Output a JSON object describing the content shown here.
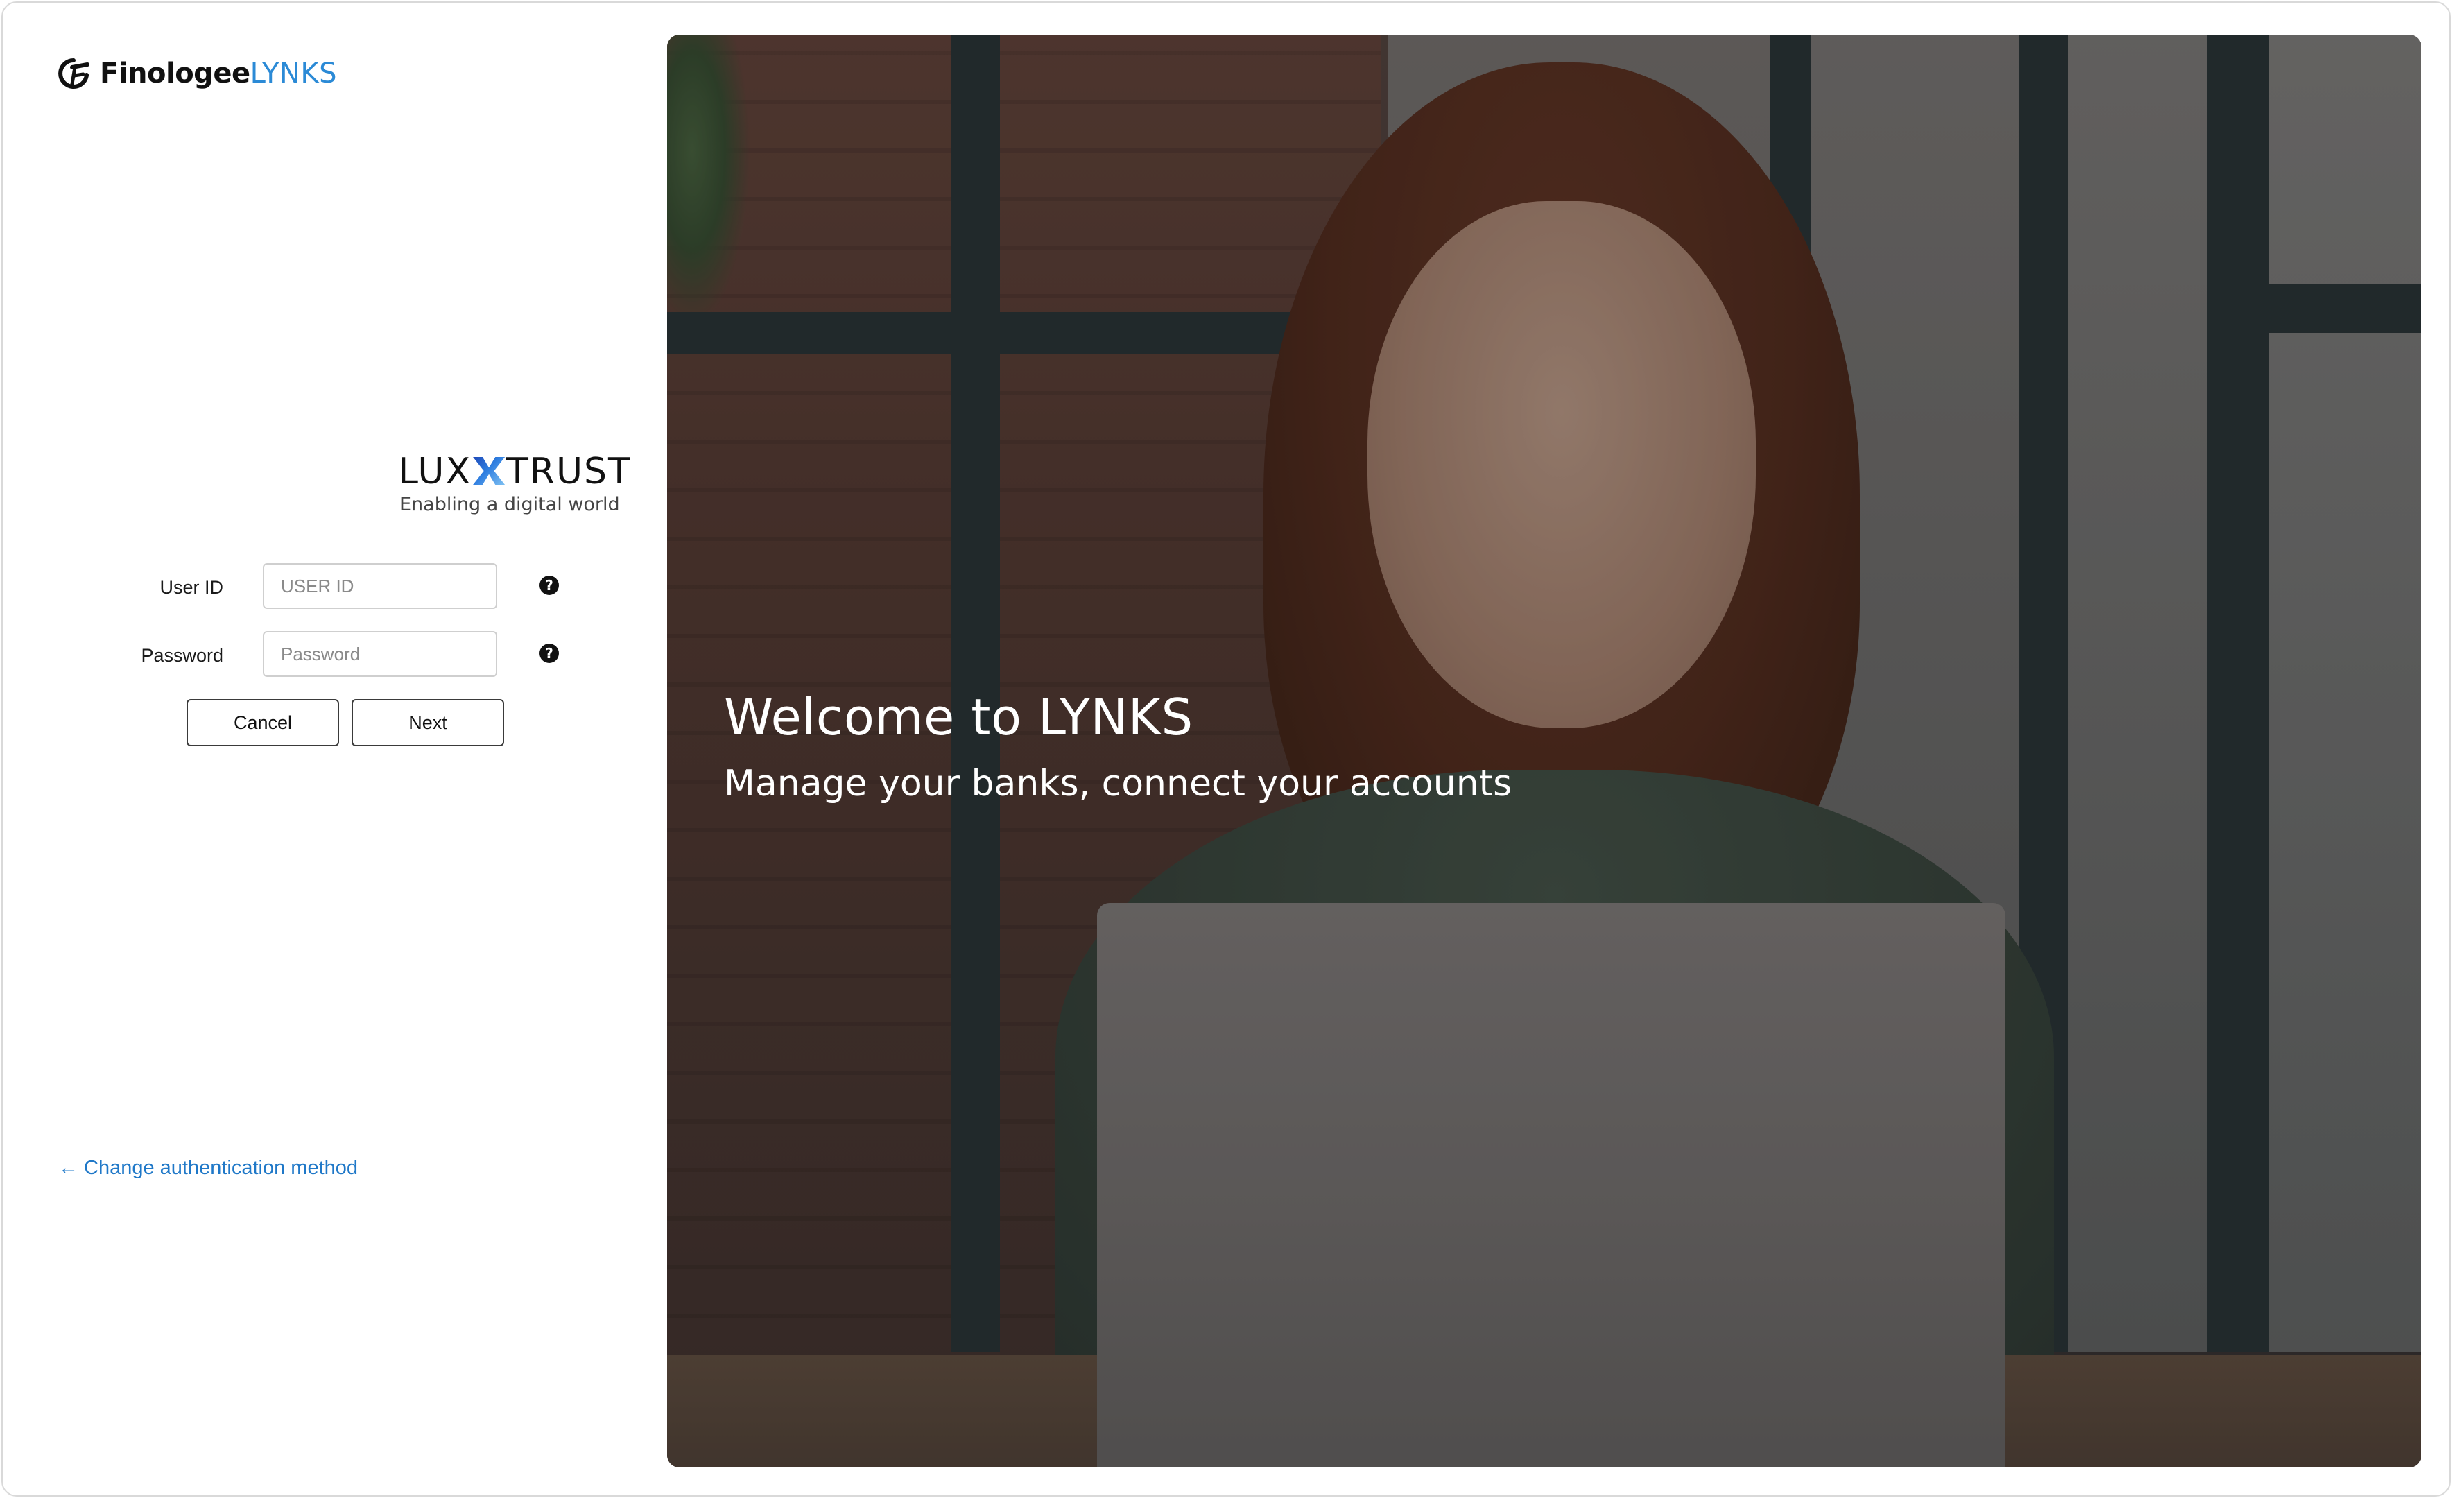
{
  "brand": {
    "name": "Finologee",
    "suffix": "LYNKS",
    "icon": "finologee-logo-icon"
  },
  "provider": {
    "logo_word_left": "LUX",
    "logo_word_right": "TRUST",
    "tagline": "Enabling a digital world"
  },
  "form": {
    "user_id": {
      "label": "User ID",
      "placeholder": "USER ID",
      "value": "",
      "help_icon": "question-circle-icon",
      "help_glyph": "?"
    },
    "password": {
      "label": "Password",
      "placeholder": "Password",
      "value": "",
      "help_icon": "question-circle-icon",
      "help_glyph": "?"
    },
    "cancel_label": "Cancel",
    "next_label": "Next"
  },
  "footer": {
    "change_auth_arrow": "←",
    "change_auth_label": "Change authentication method"
  },
  "hero": {
    "title": "Welcome to LYNKS",
    "subtitle": "Manage your banks, connect your accounts"
  },
  "colors": {
    "accent_link": "#1f78c8",
    "brand_suffix": "#2b8ad6",
    "text_primary": "#111111"
  }
}
